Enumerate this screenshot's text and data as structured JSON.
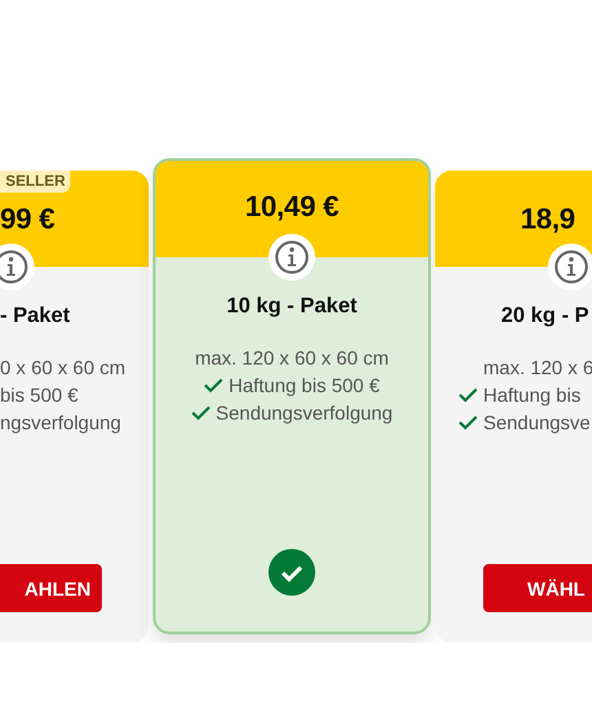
{
  "offers": [
    {
      "kind": "cut-left",
      "badge": "SELLER",
      "price": "99 €",
      "title": "- Paket",
      "features": [
        {
          "text": "0 x 60 x 60 cm"
        },
        {
          "text": "bis 500 €"
        },
        {
          "text": "ngsverfolgung"
        }
      ],
      "selected": false,
      "button": "AHLEN"
    },
    {
      "kind": "full",
      "price": "10,49 €",
      "title": "10 kg - Paket",
      "features": [
        {
          "text": "max. 120 x 60 x 60 cm",
          "check": false
        },
        {
          "text": "Haftung bis 500 €",
          "check": true
        },
        {
          "text": "Sendungsverfolgung",
          "check": true
        }
      ],
      "selected": true
    },
    {
      "kind": "cut-right",
      "price": "18,9",
      "title": "20 kg - P",
      "features": [
        {
          "text": "max. 120 x 6",
          "check": false
        },
        {
          "text": "Haftung bis",
          "check": true
        },
        {
          "text": "Sendungsve",
          "check": true
        }
      ],
      "selected": false,
      "button": "WÄHL"
    }
  ]
}
